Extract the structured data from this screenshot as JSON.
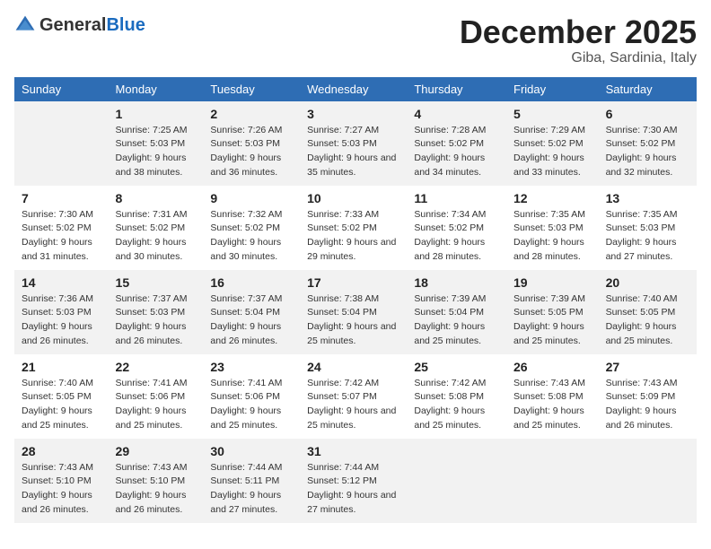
{
  "logo": {
    "text_general": "General",
    "text_blue": "Blue"
  },
  "title": {
    "month": "December 2025",
    "location": "Giba, Sardinia, Italy"
  },
  "weekdays": [
    "Sunday",
    "Monday",
    "Tuesday",
    "Wednesday",
    "Thursday",
    "Friday",
    "Saturday"
  ],
  "weeks": [
    [
      {
        "day": "",
        "sunrise": "",
        "sunset": "",
        "daylight": ""
      },
      {
        "day": "1",
        "sunrise": "Sunrise: 7:25 AM",
        "sunset": "Sunset: 5:03 PM",
        "daylight": "Daylight: 9 hours and 38 minutes."
      },
      {
        "day": "2",
        "sunrise": "Sunrise: 7:26 AM",
        "sunset": "Sunset: 5:03 PM",
        "daylight": "Daylight: 9 hours and 36 minutes."
      },
      {
        "day": "3",
        "sunrise": "Sunrise: 7:27 AM",
        "sunset": "Sunset: 5:03 PM",
        "daylight": "Daylight: 9 hours and 35 minutes."
      },
      {
        "day": "4",
        "sunrise": "Sunrise: 7:28 AM",
        "sunset": "Sunset: 5:02 PM",
        "daylight": "Daylight: 9 hours and 34 minutes."
      },
      {
        "day": "5",
        "sunrise": "Sunrise: 7:29 AM",
        "sunset": "Sunset: 5:02 PM",
        "daylight": "Daylight: 9 hours and 33 minutes."
      },
      {
        "day": "6",
        "sunrise": "Sunrise: 7:30 AM",
        "sunset": "Sunset: 5:02 PM",
        "daylight": "Daylight: 9 hours and 32 minutes."
      }
    ],
    [
      {
        "day": "7",
        "sunrise": "Sunrise: 7:30 AM",
        "sunset": "Sunset: 5:02 PM",
        "daylight": "Daylight: 9 hours and 31 minutes."
      },
      {
        "day": "8",
        "sunrise": "Sunrise: 7:31 AM",
        "sunset": "Sunset: 5:02 PM",
        "daylight": "Daylight: 9 hours and 30 minutes."
      },
      {
        "day": "9",
        "sunrise": "Sunrise: 7:32 AM",
        "sunset": "Sunset: 5:02 PM",
        "daylight": "Daylight: 9 hours and 30 minutes."
      },
      {
        "day": "10",
        "sunrise": "Sunrise: 7:33 AM",
        "sunset": "Sunset: 5:02 PM",
        "daylight": "Daylight: 9 hours and 29 minutes."
      },
      {
        "day": "11",
        "sunrise": "Sunrise: 7:34 AM",
        "sunset": "Sunset: 5:02 PM",
        "daylight": "Daylight: 9 hours and 28 minutes."
      },
      {
        "day": "12",
        "sunrise": "Sunrise: 7:35 AM",
        "sunset": "Sunset: 5:03 PM",
        "daylight": "Daylight: 9 hours and 28 minutes."
      },
      {
        "day": "13",
        "sunrise": "Sunrise: 7:35 AM",
        "sunset": "Sunset: 5:03 PM",
        "daylight": "Daylight: 9 hours and 27 minutes."
      }
    ],
    [
      {
        "day": "14",
        "sunrise": "Sunrise: 7:36 AM",
        "sunset": "Sunset: 5:03 PM",
        "daylight": "Daylight: 9 hours and 26 minutes."
      },
      {
        "day": "15",
        "sunrise": "Sunrise: 7:37 AM",
        "sunset": "Sunset: 5:03 PM",
        "daylight": "Daylight: 9 hours and 26 minutes."
      },
      {
        "day": "16",
        "sunrise": "Sunrise: 7:37 AM",
        "sunset": "Sunset: 5:04 PM",
        "daylight": "Daylight: 9 hours and 26 minutes."
      },
      {
        "day": "17",
        "sunrise": "Sunrise: 7:38 AM",
        "sunset": "Sunset: 5:04 PM",
        "daylight": "Daylight: 9 hours and 25 minutes."
      },
      {
        "day": "18",
        "sunrise": "Sunrise: 7:39 AM",
        "sunset": "Sunset: 5:04 PM",
        "daylight": "Daylight: 9 hours and 25 minutes."
      },
      {
        "day": "19",
        "sunrise": "Sunrise: 7:39 AM",
        "sunset": "Sunset: 5:05 PM",
        "daylight": "Daylight: 9 hours and 25 minutes."
      },
      {
        "day": "20",
        "sunrise": "Sunrise: 7:40 AM",
        "sunset": "Sunset: 5:05 PM",
        "daylight": "Daylight: 9 hours and 25 minutes."
      }
    ],
    [
      {
        "day": "21",
        "sunrise": "Sunrise: 7:40 AM",
        "sunset": "Sunset: 5:05 PM",
        "daylight": "Daylight: 9 hours and 25 minutes."
      },
      {
        "day": "22",
        "sunrise": "Sunrise: 7:41 AM",
        "sunset": "Sunset: 5:06 PM",
        "daylight": "Daylight: 9 hours and 25 minutes."
      },
      {
        "day": "23",
        "sunrise": "Sunrise: 7:41 AM",
        "sunset": "Sunset: 5:06 PM",
        "daylight": "Daylight: 9 hours and 25 minutes."
      },
      {
        "day": "24",
        "sunrise": "Sunrise: 7:42 AM",
        "sunset": "Sunset: 5:07 PM",
        "daylight": "Daylight: 9 hours and 25 minutes."
      },
      {
        "day": "25",
        "sunrise": "Sunrise: 7:42 AM",
        "sunset": "Sunset: 5:08 PM",
        "daylight": "Daylight: 9 hours and 25 minutes."
      },
      {
        "day": "26",
        "sunrise": "Sunrise: 7:43 AM",
        "sunset": "Sunset: 5:08 PM",
        "daylight": "Daylight: 9 hours and 25 minutes."
      },
      {
        "day": "27",
        "sunrise": "Sunrise: 7:43 AM",
        "sunset": "Sunset: 5:09 PM",
        "daylight": "Daylight: 9 hours and 26 minutes."
      }
    ],
    [
      {
        "day": "28",
        "sunrise": "Sunrise: 7:43 AM",
        "sunset": "Sunset: 5:10 PM",
        "daylight": "Daylight: 9 hours and 26 minutes."
      },
      {
        "day": "29",
        "sunrise": "Sunrise: 7:43 AM",
        "sunset": "Sunset: 5:10 PM",
        "daylight": "Daylight: 9 hours and 26 minutes."
      },
      {
        "day": "30",
        "sunrise": "Sunrise: 7:44 AM",
        "sunset": "Sunset: 5:11 PM",
        "daylight": "Daylight: 9 hours and 27 minutes."
      },
      {
        "day": "31",
        "sunrise": "Sunrise: 7:44 AM",
        "sunset": "Sunset: 5:12 PM",
        "daylight": "Daylight: 9 hours and 27 minutes."
      },
      {
        "day": "",
        "sunrise": "",
        "sunset": "",
        "daylight": ""
      },
      {
        "day": "",
        "sunrise": "",
        "sunset": "",
        "daylight": ""
      },
      {
        "day": "",
        "sunrise": "",
        "sunset": "",
        "daylight": ""
      }
    ]
  ]
}
